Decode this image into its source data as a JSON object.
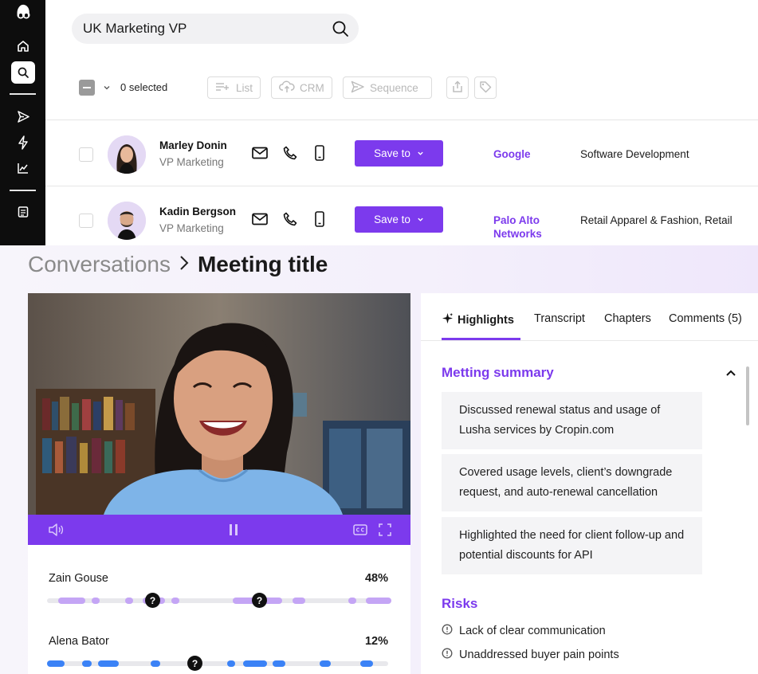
{
  "search": {
    "query": "UK Marketing VP"
  },
  "toolbar": {
    "selected": "0 selected",
    "list": "List",
    "crm": "CRM",
    "sequence": "Sequence"
  },
  "people": [
    {
      "name": "Marley Donin",
      "title": "VP Marketing",
      "action": "Save to",
      "company": "Google",
      "industry": "Software Development"
    },
    {
      "name": "Kadin Bergson",
      "title": "VP Marketing",
      "action": "Save to",
      "company": "Palo Alto Networks",
      "industry": "Retail Apparel & Fashion, Retail"
    }
  ],
  "breadcrumb": {
    "parent": "Conversations",
    "current": "Meeting title"
  },
  "speakers": [
    {
      "name": "Zain Gouse",
      "percent": "48%"
    },
    {
      "name": "Alena Bator",
      "percent": "12%"
    }
  ],
  "tabs": [
    {
      "label": "Highlights"
    },
    {
      "label": "Transcript"
    },
    {
      "label": "Chapters"
    },
    {
      "label": "Comments (5)"
    }
  ],
  "summary": {
    "title": "Metting summary",
    "items": [
      "Discussed renewal status and usage of Lusha services by Cropin.com",
      "Covered  usage levels, client’s downgrade request, and auto-renewal cancellation",
      "Highlighted the need for client follow-up and potential discounts for API"
    ]
  },
  "risks": {
    "title": "Risks",
    "items": [
      "Lack of clear communication",
      "Unaddressed buyer pain points"
    ]
  },
  "colors": {
    "accent": "#7c3aed",
    "speaker1": "#c4a5f5",
    "speaker2": "#3b82f6",
    "sidebar": "#0d0d0d"
  }
}
